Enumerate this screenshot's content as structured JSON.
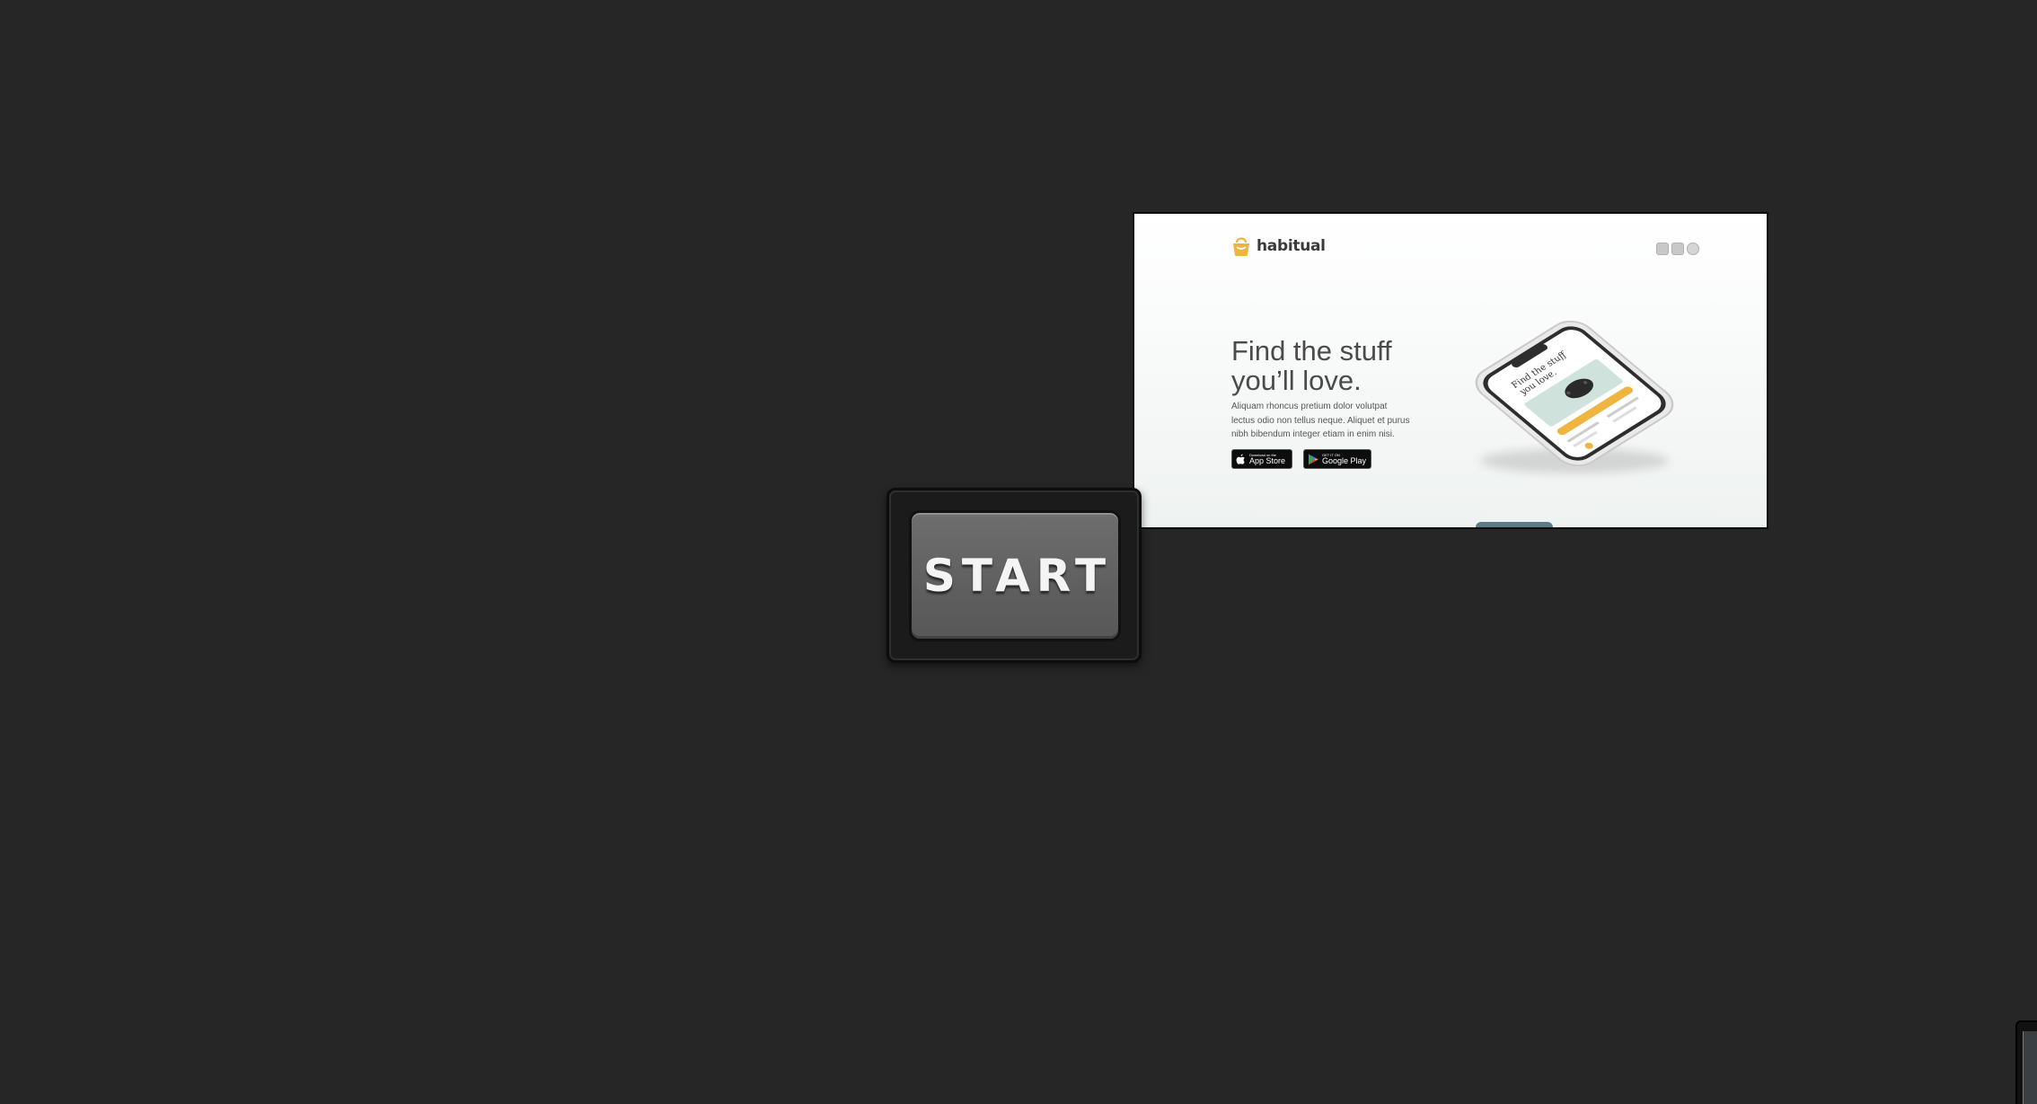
{
  "start_button": {
    "label": "START"
  },
  "preview": {
    "brand": {
      "name": "habitual",
      "icon": "shopping-bag-icon",
      "accent_color": "#f0b440"
    },
    "hero": {
      "title_line1": "Find the stuff",
      "title_line2": "you’ll love.",
      "body": "Aliquam rhoncus pretium dolor volutpat lectus odio non tellus neque. Aliquet et purus nibh bibendum integer etiam in enim nisi."
    },
    "store_buttons": [
      {
        "small": "Download on the",
        "big": "App Store",
        "icon": "apple-icon"
      },
      {
        "small": "GET IT ON",
        "big": "Google Play",
        "icon": "google-play-icon"
      }
    ],
    "phone_screen": {
      "title_line1": "Find the stuff",
      "title_line2": "you love."
    }
  },
  "colors": {
    "background": "#262626",
    "button_face": "#666666",
    "accent": "#f0b440"
  }
}
